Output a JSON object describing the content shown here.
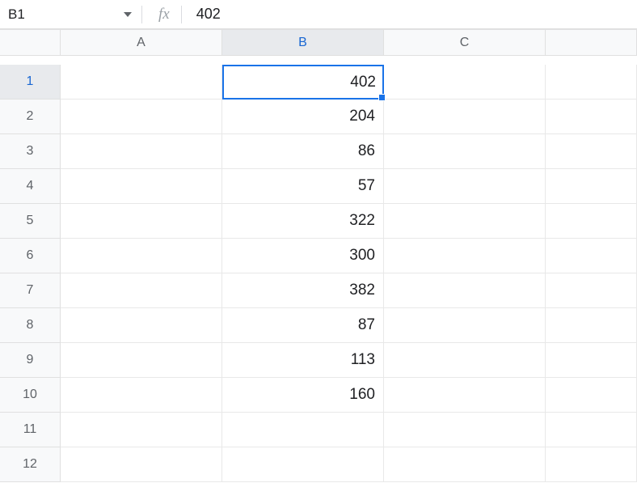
{
  "formula_bar": {
    "name_box": "B1",
    "fx_label": "fx",
    "formula_value": "402"
  },
  "columns": [
    "A",
    "B",
    "C",
    ""
  ],
  "rows": [
    {
      "num": "1",
      "A": "",
      "B": "402",
      "C": "",
      "D": ""
    },
    {
      "num": "2",
      "A": "",
      "B": "204",
      "C": "",
      "D": ""
    },
    {
      "num": "3",
      "A": "",
      "B": "86",
      "C": "",
      "D": ""
    },
    {
      "num": "4",
      "A": "",
      "B": "57",
      "C": "",
      "D": ""
    },
    {
      "num": "5",
      "A": "",
      "B": "322",
      "C": "",
      "D": ""
    },
    {
      "num": "6",
      "A": "",
      "B": "300",
      "C": "",
      "D": ""
    },
    {
      "num": "7",
      "A": "",
      "B": "382",
      "C": "",
      "D": ""
    },
    {
      "num": "8",
      "A": "",
      "B": "87",
      "C": "",
      "D": ""
    },
    {
      "num": "9",
      "A": "",
      "B": "113",
      "C": "",
      "D": ""
    },
    {
      "num": "10",
      "A": "",
      "B": "160",
      "C": "",
      "D": ""
    },
    {
      "num": "11",
      "A": "",
      "B": "",
      "C": "",
      "D": ""
    },
    {
      "num": "12",
      "A": "",
      "B": "",
      "C": "",
      "D": ""
    }
  ],
  "selected_cell": "B1",
  "chart_data": {
    "type": "table",
    "columns": [
      "A",
      "B",
      "C"
    ],
    "rows": [
      [
        "",
        402,
        ""
      ],
      [
        "",
        204,
        ""
      ],
      [
        "",
        86,
        ""
      ],
      [
        "",
        57,
        ""
      ],
      [
        "",
        322,
        ""
      ],
      [
        "",
        300,
        ""
      ],
      [
        "",
        382,
        ""
      ],
      [
        "",
        87,
        ""
      ],
      [
        "",
        113,
        ""
      ],
      [
        "",
        160,
        ""
      ],
      [
        "",
        "",
        ""
      ],
      [
        "",
        "",
        ""
      ]
    ]
  }
}
